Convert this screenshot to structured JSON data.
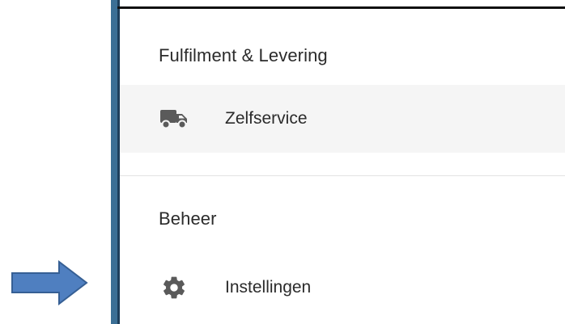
{
  "annotation": {
    "arrow_color": "#4f7fc0",
    "arrow_outline": "#365f94",
    "points_to": "Instellingen"
  },
  "panel": {
    "accent_color": "#3b6f95",
    "sections": [
      {
        "header": "Fulfilment & Levering",
        "items": [
          {
            "label": "Zelfservice",
            "icon": "truck-icon",
            "selected": true
          }
        ]
      },
      {
        "header": "Beheer",
        "items": [
          {
            "label": "Instellingen",
            "icon": "gear-icon",
            "selected": false
          }
        ]
      }
    ]
  }
}
